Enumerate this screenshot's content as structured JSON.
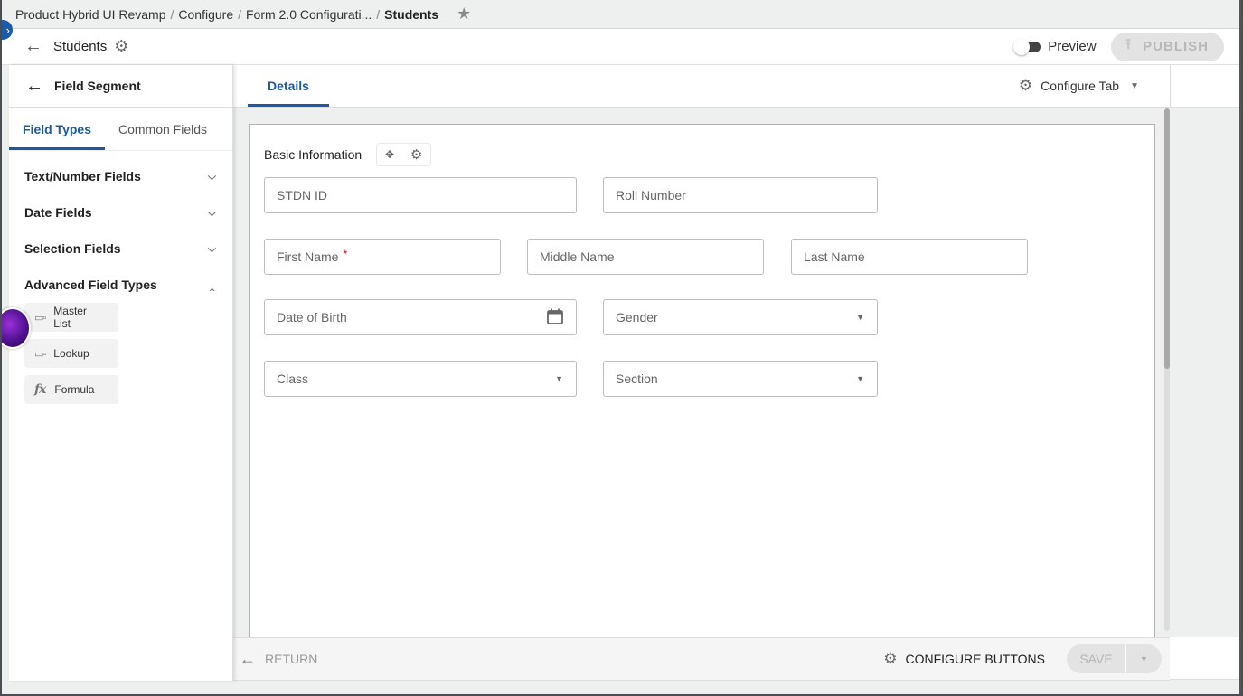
{
  "breadcrumb": {
    "items": [
      "Product Hybrid UI Revamp",
      "Configure",
      "Form 2.0 Configurati..."
    ],
    "current": "Students",
    "separator": "/"
  },
  "header": {
    "title": "Students",
    "preview_label": "Preview",
    "preview_on": false,
    "publish_label": "PUBLISH"
  },
  "left_panel": {
    "title": "Field Segment",
    "tabs": [
      {
        "label": "Field Types",
        "active": true
      },
      {
        "label": "Common Fields",
        "active": false
      }
    ],
    "sections": [
      {
        "label": "Text/Number Fields",
        "expanded": false
      },
      {
        "label": "Date Fields",
        "expanded": false
      },
      {
        "label": "Selection Fields",
        "expanded": false
      },
      {
        "label": "Advanced Field Types",
        "expanded": true
      }
    ],
    "advanced_items": [
      {
        "label": "Master List",
        "icon": "list-field-icon"
      },
      {
        "label": "Lookup",
        "icon": "lookup-field-icon"
      },
      {
        "label": "Formula",
        "icon": "fx-icon"
      }
    ]
  },
  "main": {
    "tabs": [
      {
        "label": "Details",
        "active": true
      }
    ],
    "configure_tab_label": "Configure Tab",
    "group": {
      "title": "Basic Information",
      "fields": [
        {
          "label": "STDN ID",
          "type": "text"
        },
        {
          "label": "Roll Number",
          "type": "text"
        },
        {
          "label": "First Name",
          "type": "text",
          "required": true
        },
        {
          "label": "Middle Name",
          "type": "text"
        },
        {
          "label": "Last Name",
          "type": "text"
        },
        {
          "label": "Date of Birth",
          "type": "date"
        },
        {
          "label": "Gender",
          "type": "select"
        },
        {
          "label": "Class",
          "type": "select"
        },
        {
          "label": "Section",
          "type": "select"
        }
      ]
    }
  },
  "footer": {
    "return_label": "RETURN",
    "configure_buttons_label": "CONFIGURE BUTTONS",
    "save_label": "SAVE"
  },
  "icons": {
    "arrow_left": "←",
    "gear": "⚙",
    "star": "★",
    "chevron_down": "⌄",
    "chevron_up": "⌃",
    "caret_down": "▼",
    "upload": "⭱",
    "calendar": "📅",
    "move": "✥",
    "list": "▭▫",
    "fx": "fx",
    "required": "*",
    "expand": "›"
  },
  "colors": {
    "accent": "#1a5aa6",
    "required": "#d0021b",
    "disabled_bg": "#e3e3e3",
    "disabled_text": "#b8b8b8"
  }
}
